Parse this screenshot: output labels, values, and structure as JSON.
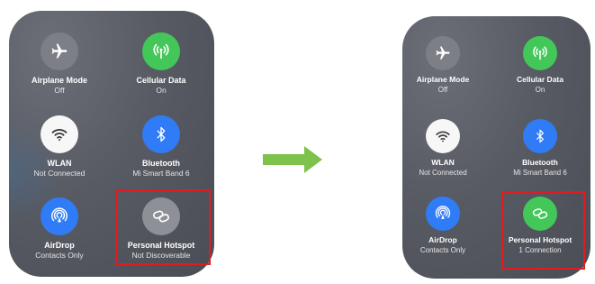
{
  "left_panel": {
    "tiles": [
      {
        "label": "Airplane Mode",
        "status": "Off",
        "icon": "airplane-icon",
        "color": "#7c7f86"
      },
      {
        "label": "Cellular Data",
        "status": "On",
        "icon": "antenna-icon",
        "color": "#43c759"
      },
      {
        "label": "WLAN",
        "status": "Not Connected",
        "icon": "wifi-icon",
        "color": "#f7f7f7"
      },
      {
        "label": "Bluetooth",
        "status": "Mi Smart Band 6",
        "icon": "bluetooth-icon",
        "color": "#2f7cf6"
      },
      {
        "label": "AirDrop",
        "status": "Contacts Only",
        "icon": "airdrop-icon",
        "color": "#2f7cf6"
      },
      {
        "label": "Personal Hotspot",
        "status": "Not Discoverable",
        "icon": "hotspot-icon",
        "color": "#8d9096"
      }
    ]
  },
  "right_panel": {
    "tiles": [
      {
        "label": "Airplane Mode",
        "status": "Off",
        "icon": "airplane-icon",
        "color": "#7c7f86"
      },
      {
        "label": "Cellular Data",
        "status": "On",
        "icon": "antenna-icon",
        "color": "#43c759"
      },
      {
        "label": "WLAN",
        "status": "Not Connected",
        "icon": "wifi-icon",
        "color": "#f7f7f7"
      },
      {
        "label": "Bluetooth",
        "status": "Mi Smart Band 6",
        "icon": "bluetooth-icon",
        "color": "#2f7cf6"
      },
      {
        "label": "AirDrop",
        "status": "Contacts Only",
        "icon": "airdrop-icon",
        "color": "#2f7cf6"
      },
      {
        "label": "Personal Hotspot",
        "status": "1 Connection",
        "icon": "hotspot-icon",
        "color": "#43c759"
      }
    ]
  },
  "arrow": {
    "icon": "right-arrow-icon",
    "color": "#7dc24b"
  },
  "highlight": {
    "color": "#e11b22"
  }
}
